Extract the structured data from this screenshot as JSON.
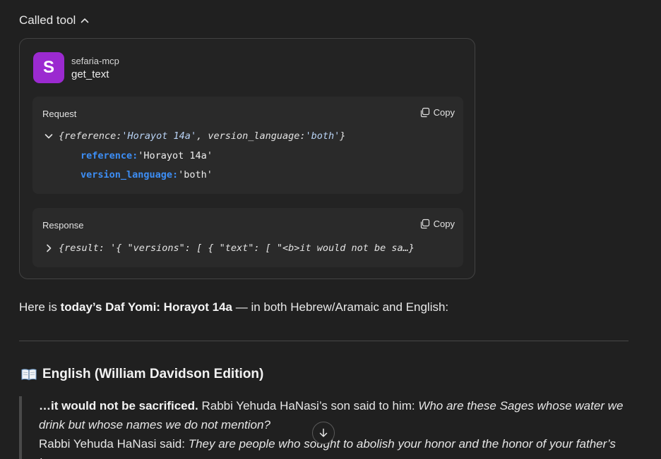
{
  "called_tool": {
    "label": "Called tool"
  },
  "tool": {
    "avatar_letter": "S",
    "server": "sefaria-mcp",
    "name": "get_text",
    "avatar_color": "#9b2ad0"
  },
  "request": {
    "label": "Request",
    "copy_label": "Copy",
    "summary_open": "{reference: ",
    "summary_ref_value": "'Horayot 14a'",
    "summary_mid": ", version_language: ",
    "summary_lang_value": "'both'",
    "summary_close": "}",
    "params": [
      {
        "key": "reference:",
        "value": "'Horayot 14a'"
      },
      {
        "key": "version_language:",
        "value": "'both'"
      }
    ]
  },
  "response": {
    "label": "Response",
    "copy_label": "Copy",
    "summary": "{result: '{ \"versions\": [ { \"text\": [ \"<b>it would not be sa…}"
  },
  "message": {
    "intro_prefix": "Here is ",
    "intro_bold": "today’s Daf Yomi: Horayot 14a",
    "intro_suffix": " — in both Hebrew/Aramaic and English:",
    "section_title": "English (William Davidson Edition)",
    "quote": {
      "p1_bold": "…it would not be sacrificed.",
      "p1_plain": " Rabbi Yehuda HaNasi’s son said to him: ",
      "p1_italic": "Who are these Sages whose water we drink but whose names we do not mention?",
      "p2_plain": "Rabbi Yehuda HaNasi said: ",
      "p2_italic": "They are people who sought to abolish your honor and the honor of your father’s house."
    }
  },
  "colors": {
    "background": "#202020",
    "param_key": "#3d8ef5",
    "string_value": "#b9d3f5"
  }
}
